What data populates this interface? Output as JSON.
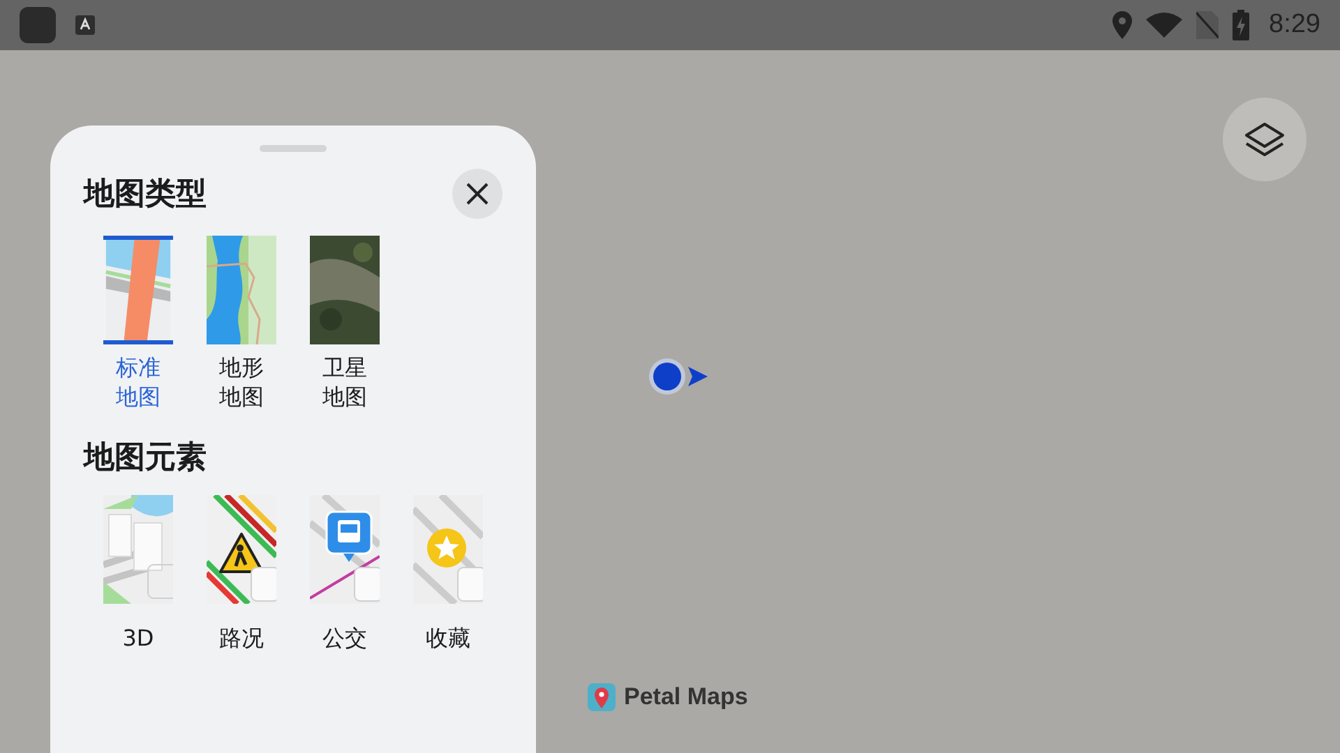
{
  "status_bar": {
    "time": "8:29"
  },
  "layer_panel": {
    "map_type": {
      "title": "地图类型",
      "items": [
        {
          "label": "标准地图",
          "kind": "standard",
          "selected": true
        },
        {
          "label": "地形地图",
          "kind": "terrain",
          "selected": false
        },
        {
          "label": "卫星地图",
          "kind": "satellite",
          "selected": false
        }
      ]
    },
    "map_elements": {
      "title": "地图元素",
      "items": [
        {
          "label": "3D",
          "kind": "buildings"
        },
        {
          "label": "路况",
          "kind": "traffic"
        },
        {
          "label": "公交",
          "kind": "transit"
        },
        {
          "label": "收藏",
          "kind": "favorites"
        }
      ]
    }
  },
  "map": {
    "logo_text": "Petal Maps"
  }
}
